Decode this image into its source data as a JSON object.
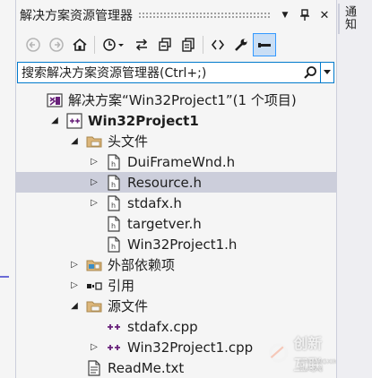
{
  "panel": {
    "title": "解决方案资源管理器",
    "pin_glyph": "▼",
    "close_glyph": "✕"
  },
  "side_tab": {
    "label": "通知"
  },
  "search": {
    "placeholder": "搜索解决方案资源管理器(Ctrl+;)"
  },
  "tree": [
    {
      "label": "解决方案“Win32Project1”(1 个项目)",
      "icon": "solution-icon",
      "expander": ""
    },
    {
      "label": "Win32Project1",
      "icon": "cpp-project-icon",
      "expander": "◢",
      "bold": true
    },
    {
      "label": "头文件",
      "icon": "filter-folder-icon",
      "expander": "◢"
    },
    {
      "label": "DuiFrameWnd.h",
      "icon": "header-file-icon",
      "expander": "▷"
    },
    {
      "label": "Resource.h",
      "icon": "header-file-icon",
      "expander": "▷",
      "selected": true
    },
    {
      "label": "stdafx.h",
      "icon": "header-file-icon",
      "expander": "▷"
    },
    {
      "label": "targetver.h",
      "icon": "header-file-icon",
      "expander": ""
    },
    {
      "label": "Win32Project1.h",
      "icon": "header-file-icon",
      "expander": ""
    },
    {
      "label": "外部依赖项",
      "icon": "external-deps-icon",
      "expander": "▷"
    },
    {
      "label": "引用",
      "icon": "references-icon",
      "expander": "▷"
    },
    {
      "label": "源文件",
      "icon": "filter-folder-icon",
      "expander": "◢"
    },
    {
      "label": "stdafx.cpp",
      "icon": "cpp-file-icon",
      "expander": ""
    },
    {
      "label": "Win32Project1.cpp",
      "icon": "cpp-file-icon",
      "expander": "▷"
    },
    {
      "label": "ReadMe.txt",
      "icon": "text-file-icon",
      "expander": ""
    }
  ],
  "watermark": {
    "text": "创新互联",
    "sub": "CHUANGXIN HULIAN"
  }
}
